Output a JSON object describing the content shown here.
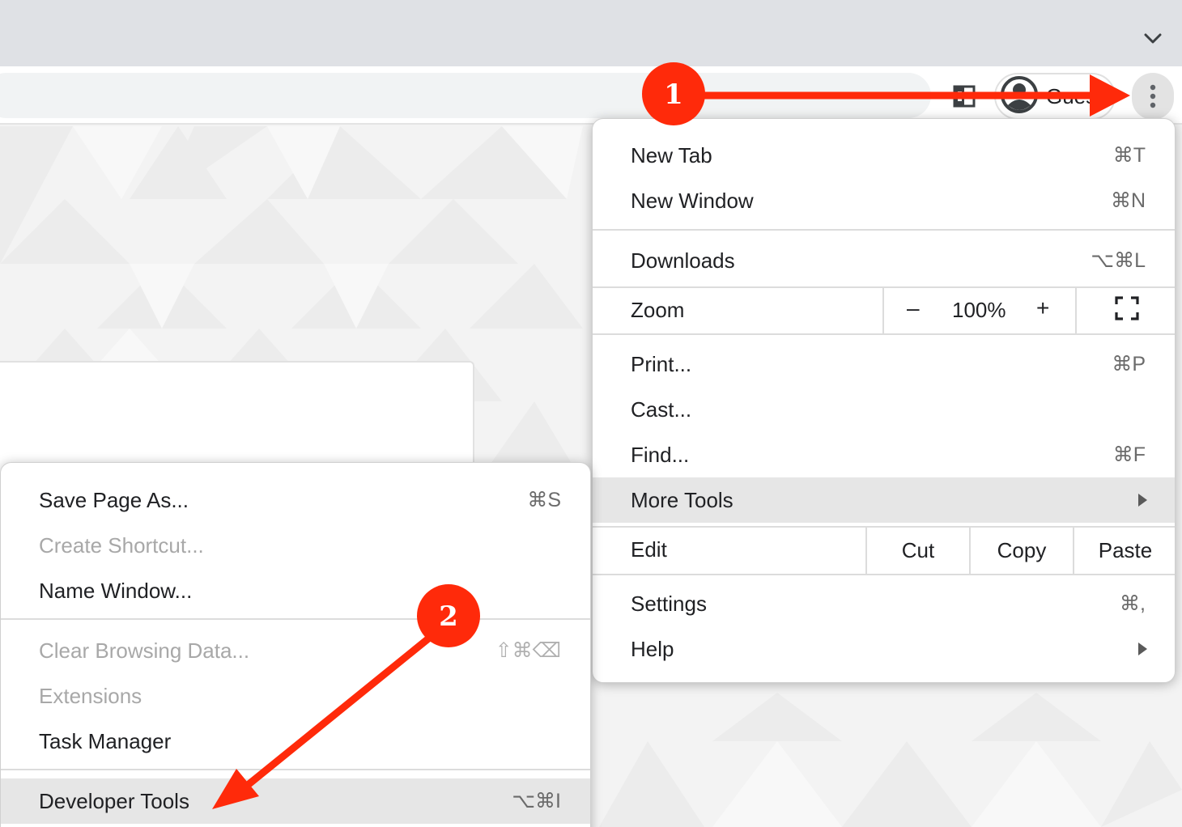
{
  "browser": {
    "profile_name": "Guest",
    "tab_dropdown_icon": "chevron-down-icon",
    "side_panel_icon": "side-panel-icon",
    "profile_icon": "person-icon",
    "menu_icon": "three-dots-vertical-icon"
  },
  "main_menu": {
    "new_tab": {
      "label": "New Tab",
      "shortcut": "⌘T"
    },
    "new_window": {
      "label": "New Window",
      "shortcut": "⌘N"
    },
    "downloads": {
      "label": "Downloads",
      "shortcut": "⌥⌘L"
    },
    "zoom": {
      "label": "Zoom",
      "minus": "–",
      "value": "100%",
      "plus": "+",
      "fullscreen_icon": "fullscreen-icon"
    },
    "print": {
      "label": "Print...",
      "shortcut": "⌘P"
    },
    "cast": {
      "label": "Cast..."
    },
    "find": {
      "label": "Find...",
      "shortcut": "⌘F"
    },
    "more_tools": {
      "label": "More Tools"
    },
    "edit": {
      "label": "Edit",
      "cut": "Cut",
      "copy": "Copy",
      "paste": "Paste"
    },
    "settings": {
      "label": "Settings",
      "shortcut": "⌘,"
    },
    "help": {
      "label": "Help"
    }
  },
  "sub_menu": {
    "save_page": {
      "label": "Save Page As...",
      "shortcut": "⌘S"
    },
    "create_shortcut": {
      "label": "Create Shortcut..."
    },
    "name_window": {
      "label": "Name Window..."
    },
    "clear_browsing": {
      "label": "Clear Browsing Data...",
      "shortcut": "⇧⌘⌫"
    },
    "extensions": {
      "label": "Extensions"
    },
    "task_manager": {
      "label": "Task Manager"
    },
    "developer_tools": {
      "label": "Developer Tools",
      "shortcut": "⌥⌘I"
    }
  },
  "annotations": {
    "step1": "1",
    "step2": "2",
    "color": "#ff2a0a"
  }
}
